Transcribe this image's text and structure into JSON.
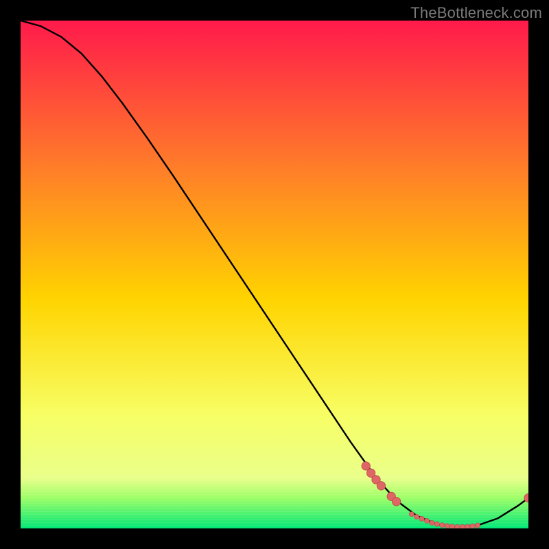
{
  "watermark": "TheBottleneck.com",
  "colors": {
    "bg": "#000000",
    "grad_top": "#ff1a4b",
    "grad_mid_upper": "#ff7a2a",
    "grad_mid": "#ffd400",
    "grad_lower": "#f7ff66",
    "grad_green1": "#9cff66",
    "grad_green2": "#00e676",
    "curve": "#000000",
    "marker_fill": "#e06666",
    "marker_stroke": "#b84a4a"
  },
  "chart_data": {
    "type": "line",
    "title": "",
    "xlabel": "",
    "ylabel": "",
    "xlim": [
      0,
      100
    ],
    "ylim": [
      0,
      100
    ],
    "grid": false,
    "legend": false,
    "curve": [
      {
        "x": 0,
        "y": 100
      },
      {
        "x": 4,
        "y": 98.9
      },
      {
        "x": 8,
        "y": 96.8
      },
      {
        "x": 12,
        "y": 93.5
      },
      {
        "x": 16,
        "y": 89.0
      },
      {
        "x": 20,
        "y": 83.8
      },
      {
        "x": 25,
        "y": 76.8
      },
      {
        "x": 30,
        "y": 69.5
      },
      {
        "x": 35,
        "y": 62.0
      },
      {
        "x": 40,
        "y": 54.5
      },
      {
        "x": 45,
        "y": 47.0
      },
      {
        "x": 50,
        "y": 39.5
      },
      {
        "x": 55,
        "y": 32.0
      },
      {
        "x": 60,
        "y": 24.5
      },
      {
        "x": 65,
        "y": 17.0
      },
      {
        "x": 70,
        "y": 10.0
      },
      {
        "x": 74,
        "y": 5.5
      },
      {
        "x": 78,
        "y": 2.5
      },
      {
        "x": 82,
        "y": 0.8
      },
      {
        "x": 86,
        "y": 0.3
      },
      {
        "x": 90,
        "y": 0.6
      },
      {
        "x": 94,
        "y": 2.0
      },
      {
        "x": 98,
        "y": 4.5
      },
      {
        "x": 100,
        "y": 6.0
      }
    ],
    "markers_large": [
      {
        "x": 68,
        "y": 12.3
      },
      {
        "x": 69,
        "y": 10.9
      },
      {
        "x": 70,
        "y": 9.6
      },
      {
        "x": 71,
        "y": 8.4
      },
      {
        "x": 73,
        "y": 6.3
      },
      {
        "x": 74,
        "y": 5.3
      },
      {
        "x": 100,
        "y": 6.0
      }
    ],
    "markers_small": [
      {
        "x": 77,
        "y": 2.8
      },
      {
        "x": 78,
        "y": 2.3
      },
      {
        "x": 79,
        "y": 1.9
      },
      {
        "x": 80,
        "y": 1.5
      },
      {
        "x": 81,
        "y": 1.1
      },
      {
        "x": 82,
        "y": 0.85
      },
      {
        "x": 83,
        "y": 0.65
      },
      {
        "x": 84,
        "y": 0.5
      },
      {
        "x": 85,
        "y": 0.38
      },
      {
        "x": 86,
        "y": 0.3
      },
      {
        "x": 87,
        "y": 0.3
      },
      {
        "x": 88,
        "y": 0.35
      },
      {
        "x": 89,
        "y": 0.45
      },
      {
        "x": 90,
        "y": 0.6
      }
    ]
  }
}
